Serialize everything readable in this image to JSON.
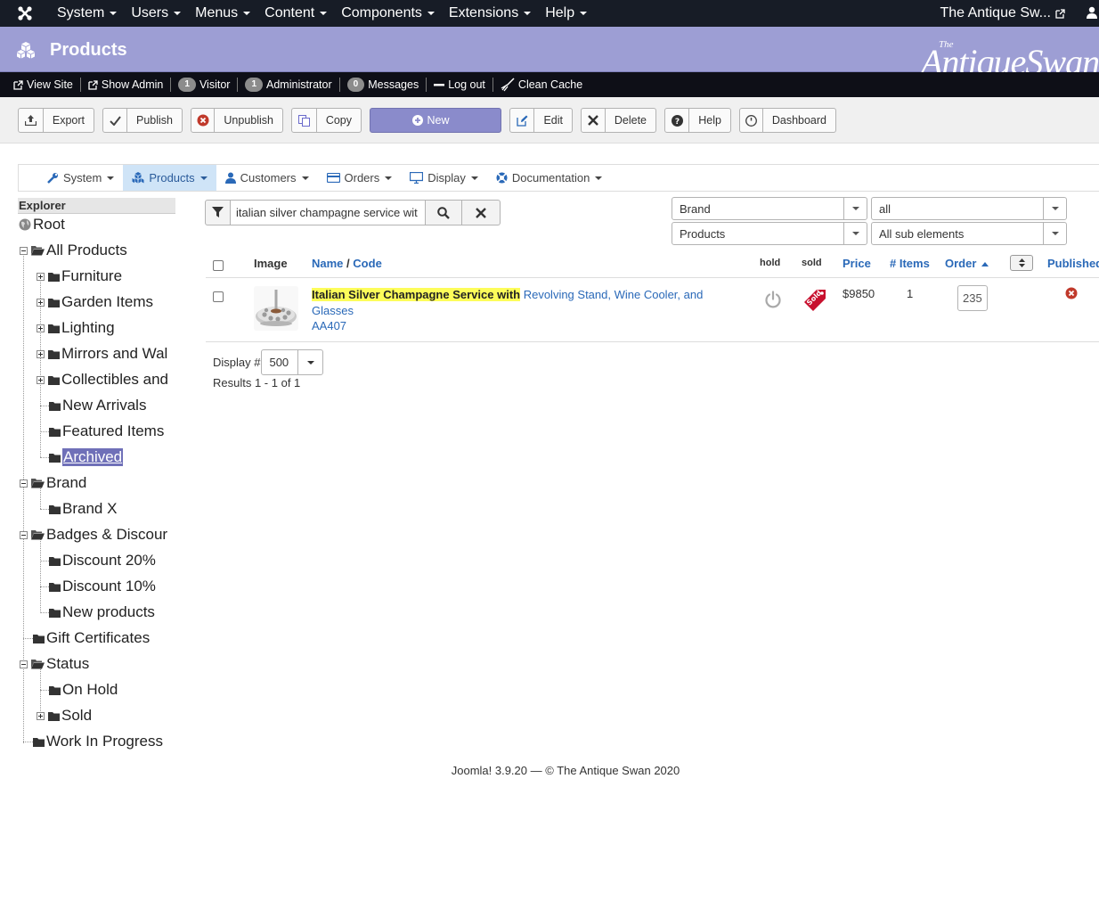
{
  "topnav": {
    "menu": [
      "System",
      "Users",
      "Menus",
      "Content",
      "Components",
      "Extensions",
      "Help"
    ],
    "site_name": "The Antique Sw..."
  },
  "header": {
    "title": "Products",
    "brand_small": "The",
    "brand": "AntiqueSwan"
  },
  "statusbar": {
    "view_site": "View Site",
    "show_admin": "Show Admin",
    "visitor_count": "1",
    "visitor_label": "Visitor",
    "admin_count": "1",
    "admin_label": "Administrator",
    "messages_count": "0",
    "messages_label": "Messages",
    "logout": "Log out",
    "clean_cache": "Clean Cache"
  },
  "toolbar": {
    "export": "Export",
    "publish": "Publish",
    "unpublish": "Unpublish",
    "copy": "Copy",
    "new": "New",
    "edit": "Edit",
    "delete": "Delete",
    "help": "Help",
    "dashboard": "Dashboard"
  },
  "subnav": {
    "items": [
      "System",
      "Products",
      "Customers",
      "Orders",
      "Display",
      "Documentation"
    ],
    "active": "Products"
  },
  "explorer": {
    "title": "Explorer",
    "nodes": [
      {
        "label": "Root"
      },
      {
        "label": "All Products"
      },
      {
        "label": "Furniture"
      },
      {
        "label": "Garden Items"
      },
      {
        "label": "Lighting"
      },
      {
        "label": "Mirrors and Wal"
      },
      {
        "label": "Collectibles and"
      },
      {
        "label": "New Arrivals"
      },
      {
        "label": "Featured Items"
      },
      {
        "label": "Archived"
      },
      {
        "label": "Brand"
      },
      {
        "label": "Brand X"
      },
      {
        "label": "Badges & Discour"
      },
      {
        "label": "Discount 20%"
      },
      {
        "label": "Discount 10%"
      },
      {
        "label": "New products"
      },
      {
        "label": "Gift Certificates"
      },
      {
        "label": "Status"
      },
      {
        "label": "On Hold"
      },
      {
        "label": "Sold"
      },
      {
        "label": "Work In Progress"
      }
    ],
    "selected": "Archived"
  },
  "search": {
    "value": "italian silver champagne service wit"
  },
  "filters": {
    "brand": "Brand",
    "all": "all",
    "products": "Products",
    "sub_elements": "All sub elements"
  },
  "table": {
    "headers": {
      "image": "Image",
      "name": "Name",
      "sep": "/",
      "code": "Code",
      "hold": "hold",
      "sold": "sold",
      "price": "Price",
      "items": "# Items",
      "order": "Order",
      "published": "Published"
    },
    "rows": [
      {
        "name_highlight": "Italian Silver Champagne Service with",
        "name_rest": " Revolving Stand, Wine Cooler, and Glasses",
        "code": "AA407",
        "price": "$9850",
        "items": "1",
        "order": "235",
        "sold_badge": "Sold"
      }
    ]
  },
  "pagination": {
    "display_label": "Display #",
    "display_value": "500",
    "results": "Results 1 - 1 of 1"
  },
  "footer": {
    "text": "Joomla! 3.9.20  —  © The Antique Swan 2020"
  }
}
